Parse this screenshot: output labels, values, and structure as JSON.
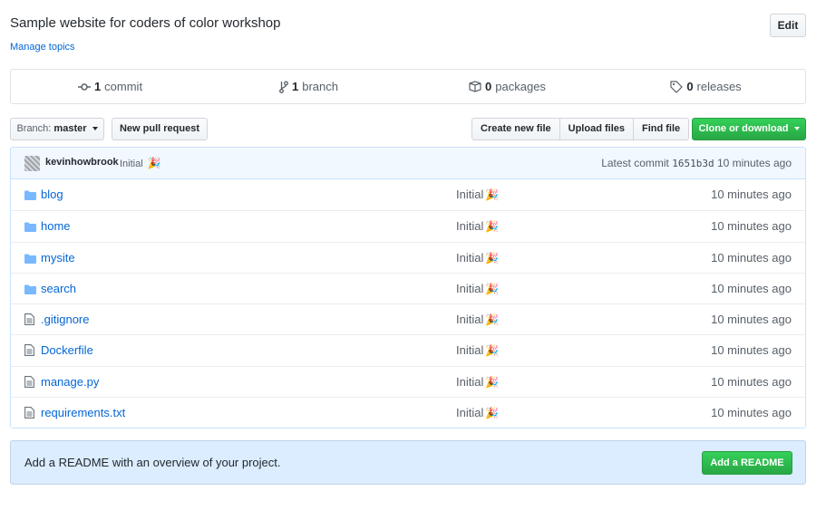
{
  "repo": {
    "description": "Sample website for coders of color workshop",
    "edit_label": "Edit",
    "manage_topics": "Manage topics"
  },
  "numbers": {
    "commits_count": "1",
    "commits_label": "commit",
    "branches_count": "1",
    "branches_label": "branch",
    "packages_count": "0",
    "packages_label": "packages",
    "releases_count": "0",
    "releases_label": "releases"
  },
  "toolbar": {
    "branch_prefix": "Branch:",
    "branch_name": "master",
    "new_pull_request": "New pull request",
    "create_new_file": "Create new file",
    "upload_files": "Upload files",
    "find_file": "Find file",
    "clone_or_download": "Clone or download"
  },
  "commit": {
    "author": "kevinhowbrook",
    "message": "Initial",
    "emoji": "🎉",
    "latest_label": "Latest commit",
    "sha": "1651b3d",
    "age": "10 minutes ago"
  },
  "files": [
    {
      "name": "blog",
      "type": "folder",
      "message": "Initial",
      "age": "10 minutes ago"
    },
    {
      "name": "home",
      "type": "folder",
      "message": "Initial",
      "age": "10 minutes ago"
    },
    {
      "name": "mysite",
      "type": "folder",
      "message": "Initial",
      "age": "10 minutes ago"
    },
    {
      "name": "search",
      "type": "folder",
      "message": "Initial",
      "age": "10 minutes ago"
    },
    {
      "name": ".gitignore",
      "type": "file",
      "message": "Initial",
      "age": "10 minutes ago"
    },
    {
      "name": "Dockerfile",
      "type": "file",
      "message": "Initial",
      "age": "10 minutes ago"
    },
    {
      "name": "manage.py",
      "type": "file",
      "message": "Initial",
      "age": "10 minutes ago"
    },
    {
      "name": "requirements.txt",
      "type": "file",
      "message": "Initial",
      "age": "10 minutes ago"
    }
  ],
  "readme": {
    "prompt": "Add a README with an overview of your project.",
    "button": "Add a README"
  },
  "colors": {
    "link": "#0366d6",
    "green": "#28a745",
    "folder": "#79b8ff"
  }
}
